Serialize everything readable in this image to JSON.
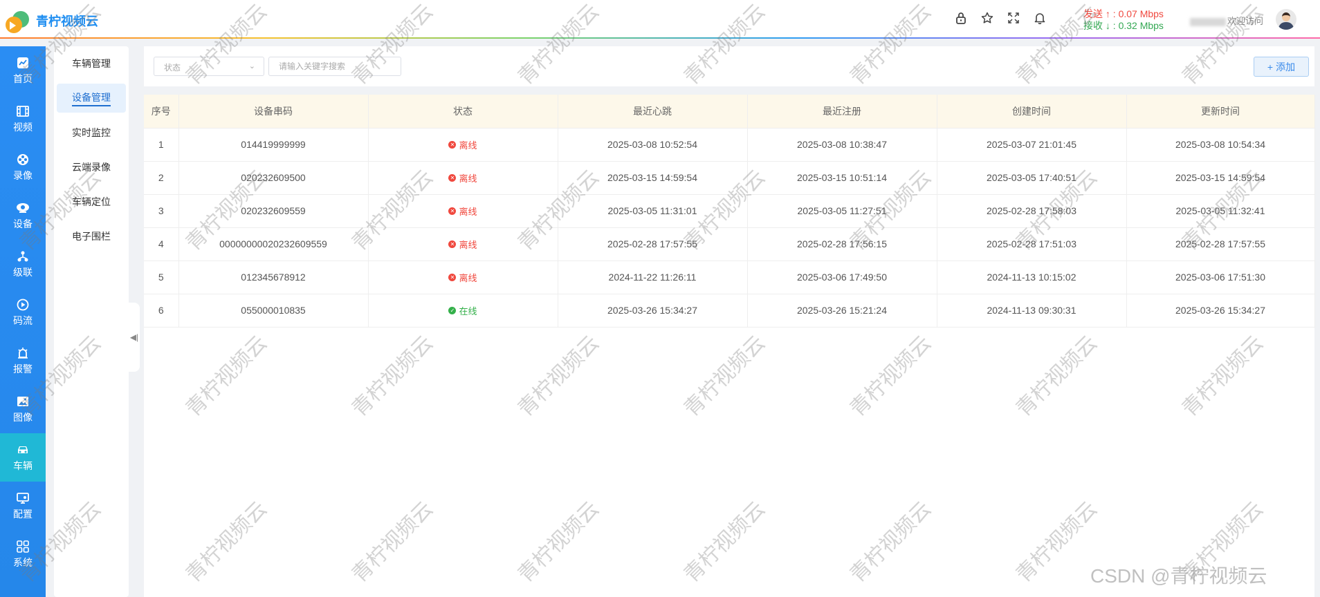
{
  "app": {
    "title": "青柠视频云"
  },
  "header": {
    "icons": [
      "lock-icon",
      "star-icon",
      "fullscreen-icon",
      "bell-icon"
    ],
    "speed": {
      "send_label": "发送 ↑ :",
      "send_value": "0.07 Mbps",
      "recv_label": "接收 ↓ :",
      "recv_value": "0.32 Mbps"
    },
    "welcome": "欢迎访问"
  },
  "leftnav": {
    "items": [
      {
        "label": "首页",
        "icon": "chart-icon"
      },
      {
        "label": "视频",
        "icon": "film-icon"
      },
      {
        "label": "录像",
        "icon": "reel-icon"
      },
      {
        "label": "设备",
        "icon": "camera-icon"
      },
      {
        "label": "级联",
        "icon": "cascade-icon"
      },
      {
        "label": "码流",
        "icon": "stream-icon"
      },
      {
        "label": "报警",
        "icon": "alarm-icon"
      },
      {
        "label": "图像",
        "icon": "image-icon"
      },
      {
        "label": "车辆",
        "icon": "car-icon"
      },
      {
        "label": "配置",
        "icon": "config-icon"
      },
      {
        "label": "系统",
        "icon": "grid-icon"
      }
    ],
    "active": "车辆"
  },
  "subnav": {
    "items": [
      "车辆管理",
      "设备管理",
      "实时监控",
      "云端录像",
      "车辆定位",
      "电子围栏"
    ],
    "active": "设备管理"
  },
  "toolbar": {
    "status_placeholder": "状态",
    "search_placeholder": "请输入关键字搜索",
    "add_label": "添加"
  },
  "table": {
    "headers": [
      "序号",
      "设备串码",
      "状态",
      "最近心跳",
      "最近注册",
      "创建时间",
      "更新时间"
    ],
    "rows": [
      {
        "no": "1",
        "sn": "014419999999",
        "status": "离线",
        "online": false,
        "heartbeat": "2025-03-08 10:52:54",
        "register": "2025-03-08 10:38:47",
        "created": "2025-03-07 21:01:45",
        "updated": "2025-03-08 10:54:34"
      },
      {
        "no": "2",
        "sn": "020232609500",
        "status": "离线",
        "online": false,
        "heartbeat": "2025-03-15 14:59:54",
        "register": "2025-03-15 10:51:14",
        "created": "2025-03-05 17:40:51",
        "updated": "2025-03-15 14:59:54"
      },
      {
        "no": "3",
        "sn": "020232609559",
        "status": "离线",
        "online": false,
        "heartbeat": "2025-03-05 11:31:01",
        "register": "2025-03-05 11:27:51",
        "created": "2025-02-28 17:58:03",
        "updated": "2025-03-05 11:32:41"
      },
      {
        "no": "4",
        "sn": "00000000020232609559",
        "status": "离线",
        "online": false,
        "heartbeat": "2025-02-28 17:57:55",
        "register": "2025-02-28 17:56:15",
        "created": "2025-02-28 17:51:03",
        "updated": "2025-02-28 17:57:55"
      },
      {
        "no": "5",
        "sn": "012345678912",
        "status": "离线",
        "online": false,
        "heartbeat": "2024-11-22 11:26:11",
        "register": "2025-03-06 17:49:50",
        "created": "2024-11-13 10:15:02",
        "updated": "2025-03-06 17:51:30"
      },
      {
        "no": "6",
        "sn": "055000010835",
        "status": "在线",
        "online": true,
        "heartbeat": "2025-03-26 15:34:27",
        "register": "2025-03-26 15:21:24",
        "created": "2024-11-13 09:30:31",
        "updated": "2025-03-26 15:34:27"
      }
    ]
  },
  "watermark": "青柠视频云",
  "footer_watermark": "CSDN @青柠视频云",
  "colors": {
    "brand": "#1f8ef1",
    "offline": "#f0483e",
    "online": "#34b04a",
    "nav": "#2587ea",
    "nav_active": "#20b8d6"
  }
}
